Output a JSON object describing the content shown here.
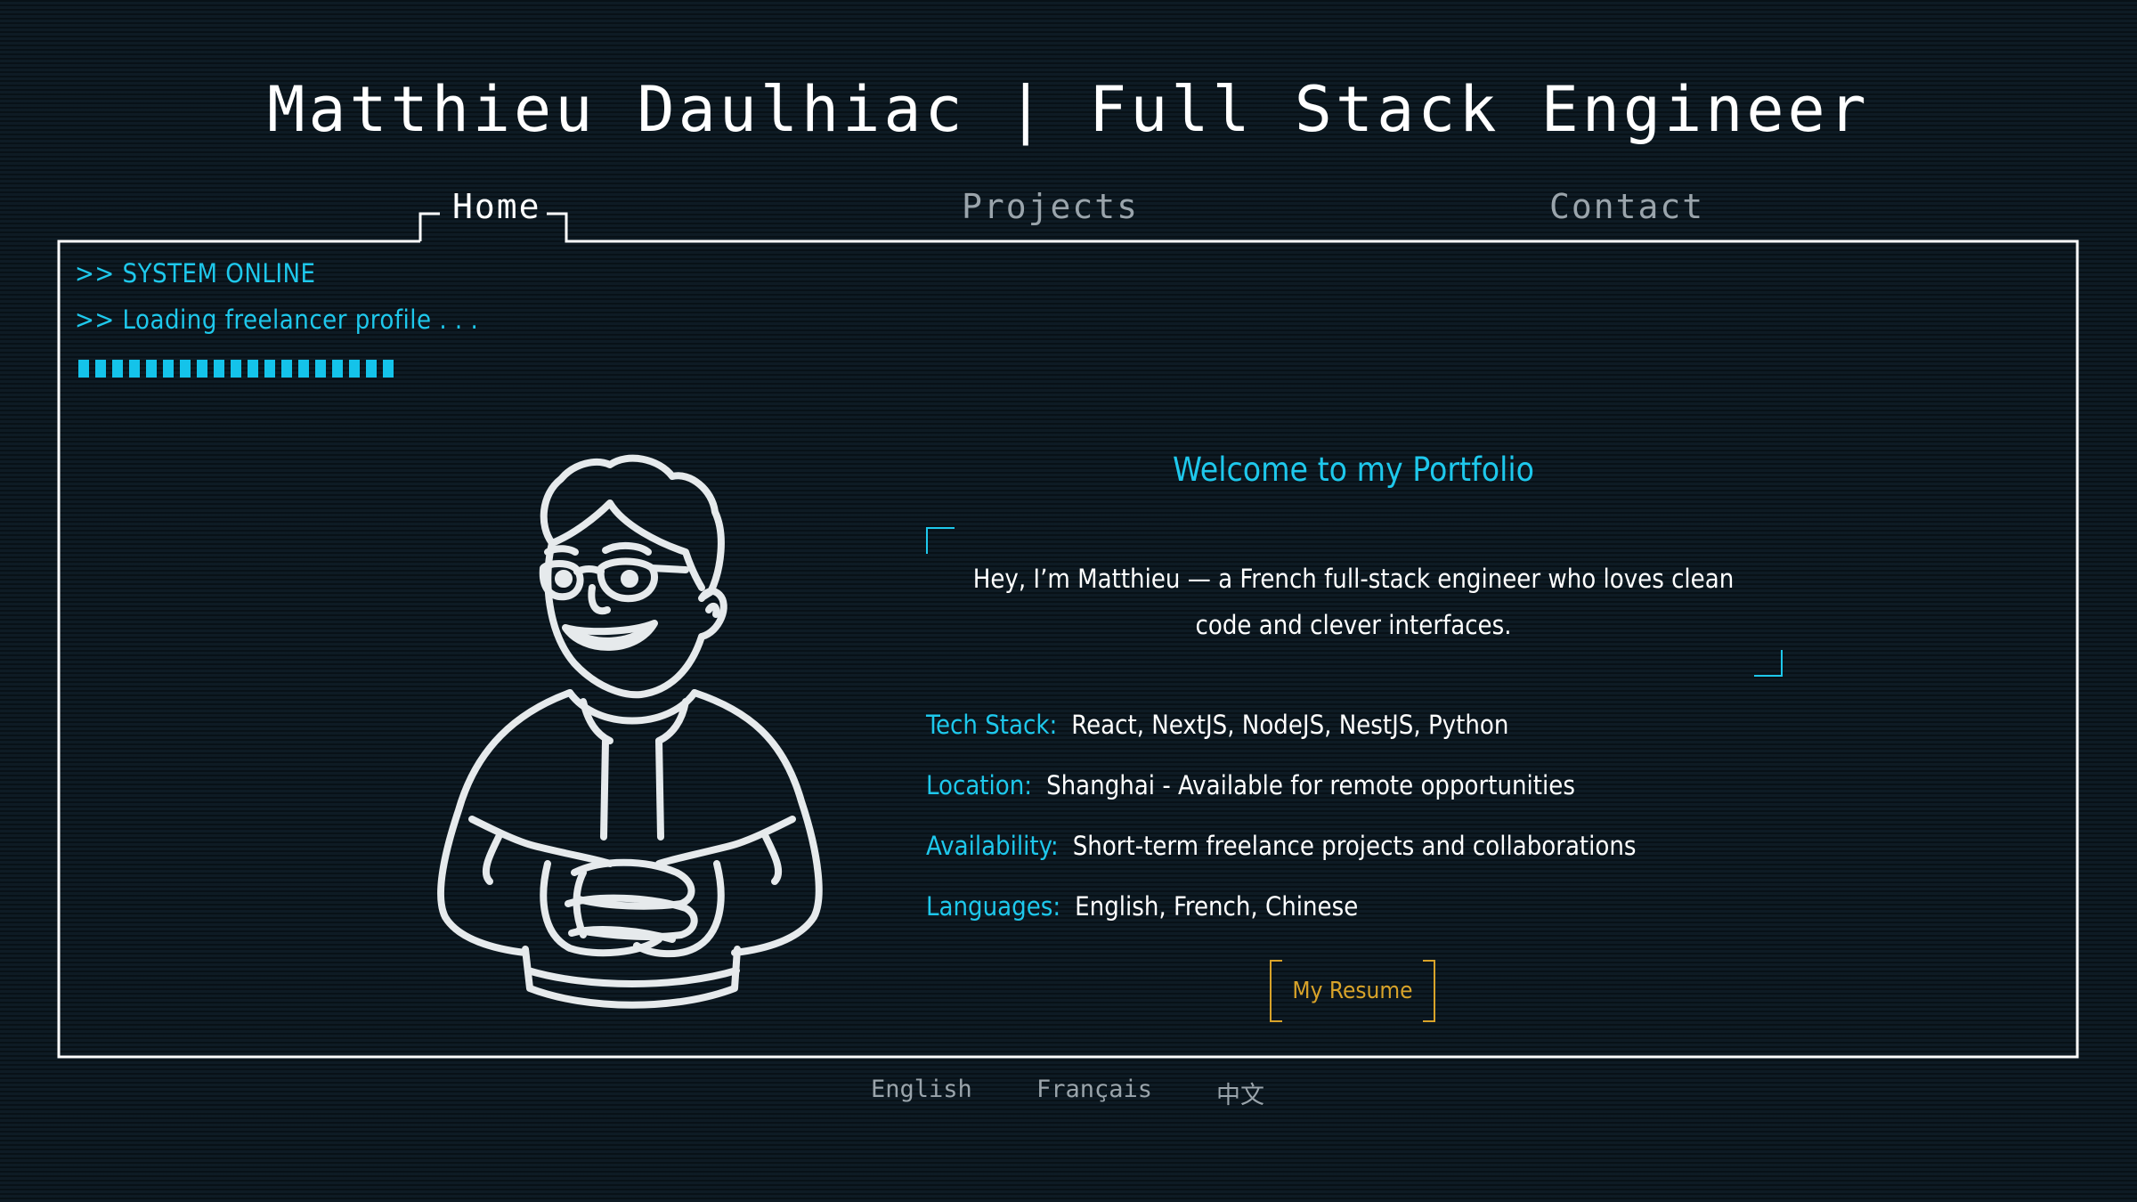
{
  "header": {
    "title": "Matthieu Daulhiac | Full Stack Engineer"
  },
  "nav": {
    "tabs": [
      {
        "label": "Home",
        "active": true
      },
      {
        "label": "Projects",
        "active": false
      },
      {
        "label": "Contact",
        "active": false
      }
    ]
  },
  "terminal": {
    "line1": ">> SYSTEM ONLINE",
    "line2": ">> Loading freelancer profile . . .",
    "progress": 1.0
  },
  "main": {
    "welcome": "Welcome to my Portfolio",
    "intro": "Hey, I’m Matthieu — a French full-stack engineer who loves clean code and clever interfaces.",
    "info": [
      {
        "label": "Tech Stack:",
        "value": "React, NextJS, NodeJS, NestJS, Python"
      },
      {
        "label": "Location:",
        "value": "Shanghai - Available for remote opportunities"
      },
      {
        "label": "Availability:",
        "value": "Short-term freelance projects and collaborations"
      },
      {
        "label": "Languages:",
        "value": "English, French, Chinese"
      }
    ],
    "resume_label": "My Resume"
  },
  "footer": {
    "languages": [
      "English",
      "Français",
      "中文"
    ]
  },
  "colors": {
    "background": "#0b1821",
    "accent": "#1ec8ec",
    "button": "#d8a32a",
    "text": "#ffffff",
    "muted": "#9aa4ab"
  },
  "icons": {
    "avatar": "cartoon-developer-avatar"
  }
}
